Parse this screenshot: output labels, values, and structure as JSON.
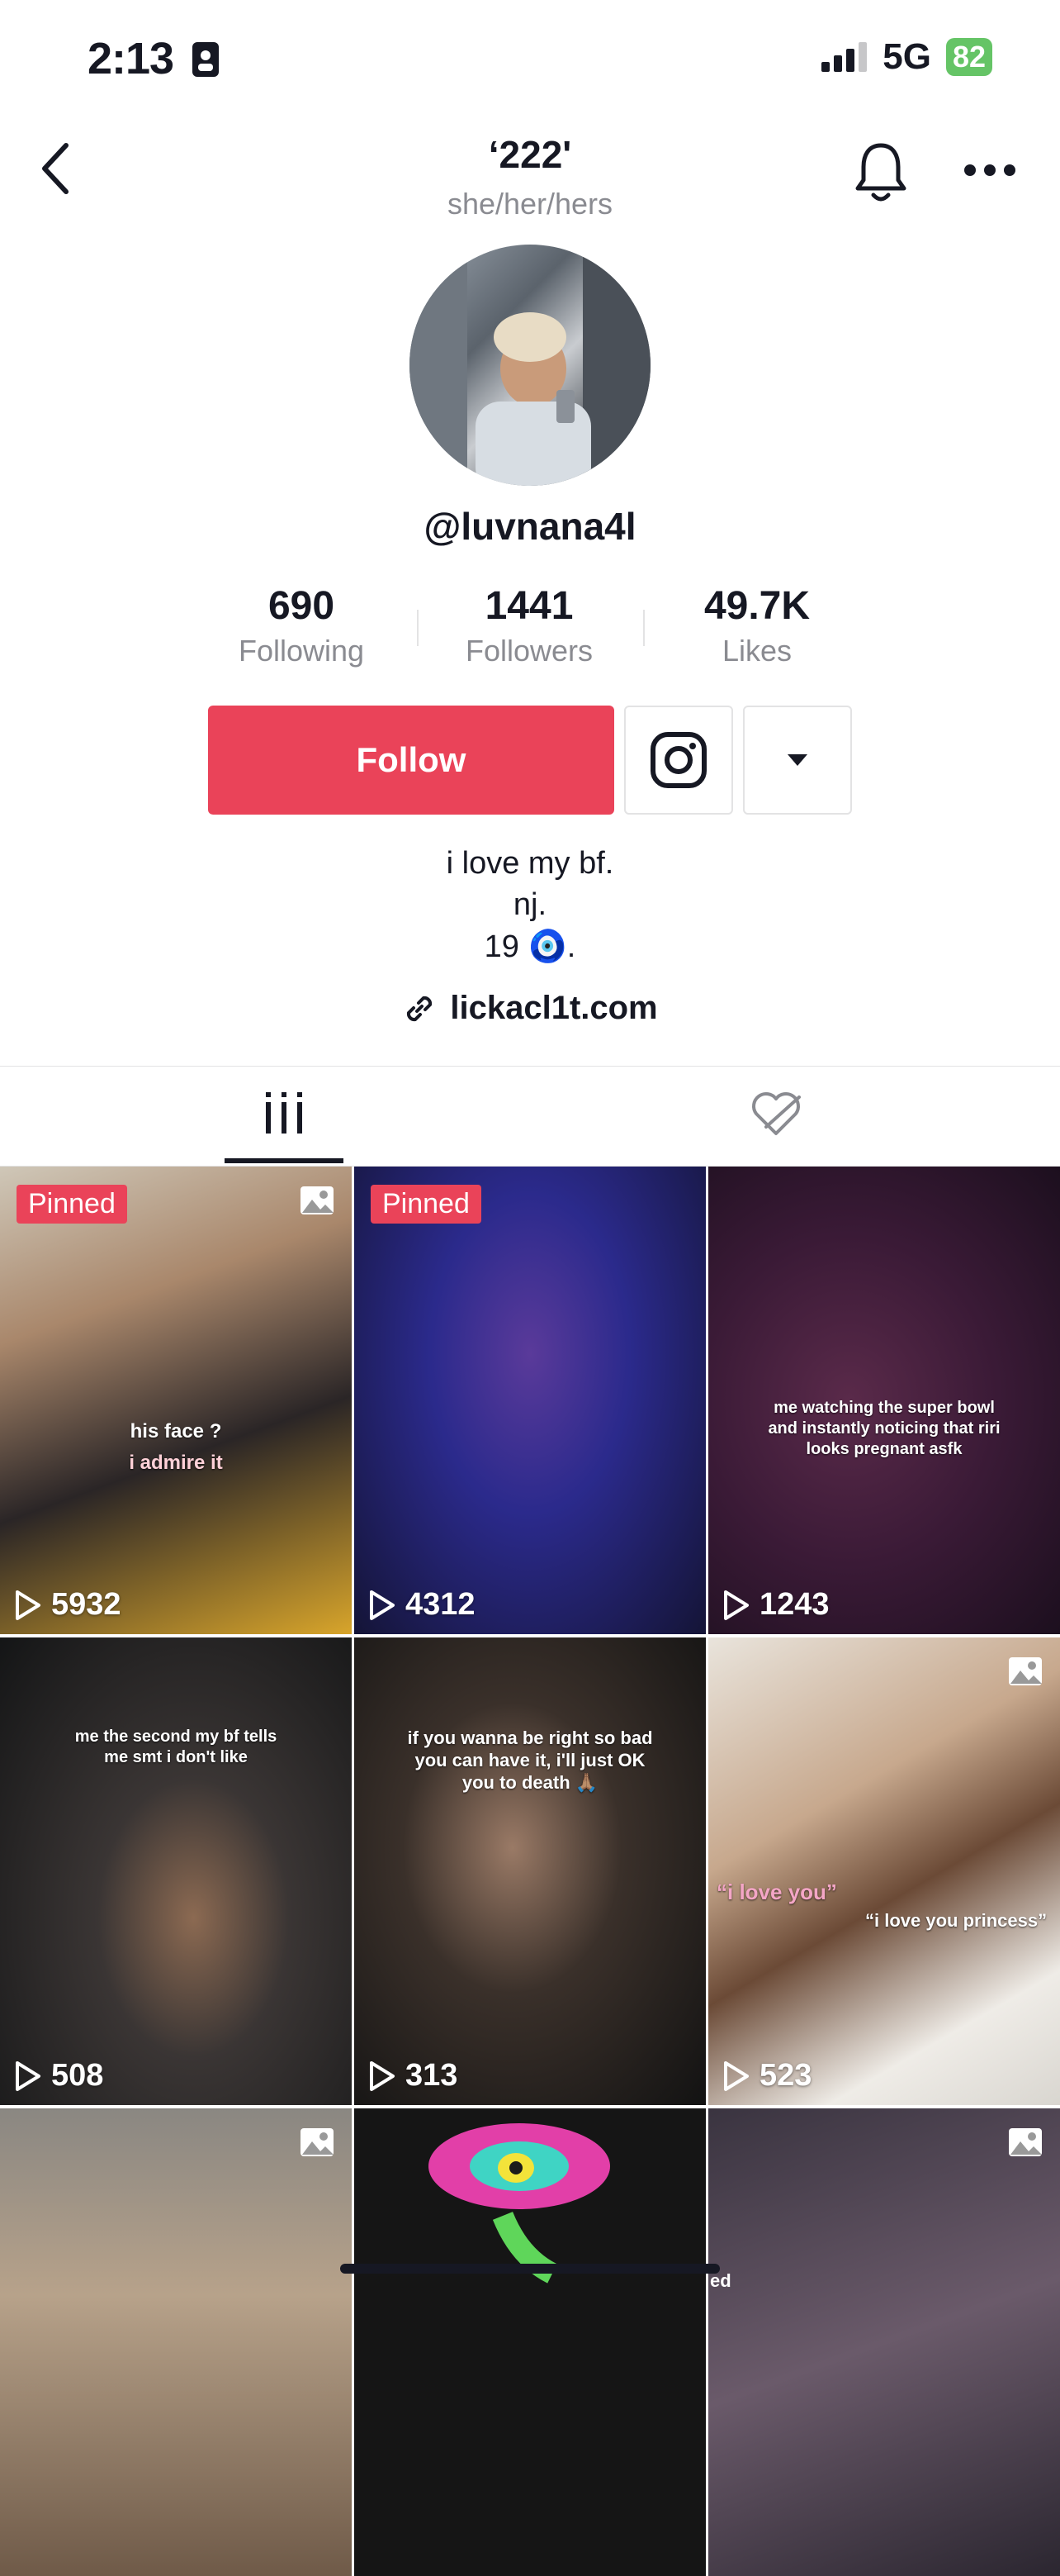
{
  "status_bar": {
    "time": "2:13",
    "network": "5G",
    "battery": "82"
  },
  "header": {
    "title": "‘222'",
    "pronouns": "she/her/hers"
  },
  "profile": {
    "username": "@luvnana4l",
    "stats": [
      {
        "value": "690",
        "label": "Following"
      },
      {
        "value": "1441",
        "label": "Followers"
      },
      {
        "value": "49.7K",
        "label": "Likes"
      }
    ],
    "follow_label": "Follow",
    "bio": [
      "i love my bf.",
      "nj.",
      "19 🧿."
    ],
    "link": "lickacl1t.com"
  },
  "grid": [
    {
      "pinned": "Pinned",
      "views": "5932",
      "caption1": "his face ?",
      "caption2": "i admire it"
    },
    {
      "pinned": "Pinned",
      "views": "4312"
    },
    {
      "views": "1243",
      "caption1": "me watching the super bowl\nand instantly noticing that riri\nlooks pregnant asfk"
    },
    {
      "views": "508",
      "caption1": "me the second my bf tells\nme smt i don't like"
    },
    {
      "views": "313",
      "caption1": "if you wanna be right so bad\nyou can have it, i'll just OK\nyou to death 🙏🏽"
    },
    {
      "views": "523",
      "caption1": "“i love you”",
      "caption2": "“i love you princess”"
    }
  ],
  "bottom_row_partial_text": "ed"
}
